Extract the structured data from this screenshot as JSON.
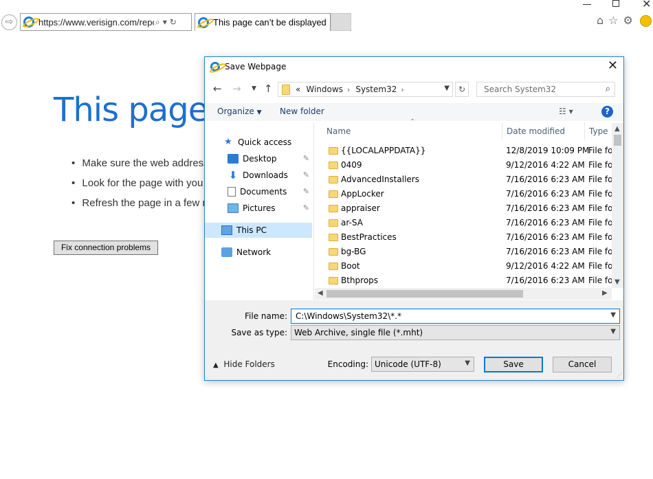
{
  "browser": {
    "address": "https://www.verisign.com/repos",
    "tab_title": "This page can’t be displayed"
  },
  "error_page": {
    "title": "This page",
    "bullets": [
      "Make sure the web address",
      "Look for the page with you",
      "Refresh the page in a few m"
    ],
    "fix_button": "Fix connection problems"
  },
  "dialog": {
    "title": "Save Webpage",
    "breadcrumb": {
      "prefix": "«",
      "items": [
        "Windows",
        "System32"
      ]
    },
    "search_placeholder": "Search System32",
    "toolbar": {
      "organize": "Organize",
      "new_folder": "New folder"
    },
    "nav_pane": {
      "quick_access": "Quick access",
      "items": [
        "Desktop",
        "Downloads",
        "Documents",
        "Pictures"
      ],
      "this_pc": "This PC",
      "network": "Network"
    },
    "columns": {
      "name": "Name",
      "date": "Date modified",
      "type": "Type"
    },
    "files": [
      {
        "name": "{{LOCALAPPDATA}}",
        "date": "12/8/2019 10:09 PM",
        "type": "File fol"
      },
      {
        "name": "0409",
        "date": "9/12/2016 4:22 AM",
        "type": "File fol"
      },
      {
        "name": "AdvancedInstallers",
        "date": "7/16/2016 6:23 AM",
        "type": "File fol"
      },
      {
        "name": "AppLocker",
        "date": "7/16/2016 6:23 AM",
        "type": "File fol"
      },
      {
        "name": "appraiser",
        "date": "7/16/2016 6:23 AM",
        "type": "File fol"
      },
      {
        "name": "ar-SA",
        "date": "7/16/2016 6:23 AM",
        "type": "File fol"
      },
      {
        "name": "BestPractices",
        "date": "7/16/2016 6:23 AM",
        "type": "File fol"
      },
      {
        "name": "bg-BG",
        "date": "7/16/2016 6:23 AM",
        "type": "File fol"
      },
      {
        "name": "Boot",
        "date": "9/12/2016 4:22 AM",
        "type": "File fol"
      },
      {
        "name": "Bthprops",
        "date": "7/16/2016 6:23 AM",
        "type": "File fol"
      }
    ],
    "file_name_label": "File name:",
    "file_name_value": "C:\\Windows\\System32\\*.*",
    "save_as_type_label": "Save as type:",
    "save_as_type_value": "Web Archive, single file (*.mht)",
    "hide_folders": "Hide Folders",
    "encoding_label": "Encoding:",
    "encoding_value": "Unicode (UTF-8)",
    "save_button": "Save",
    "cancel_button": "Cancel"
  },
  "colors": {
    "accent": "#0078d7",
    "error_title": "#1e6fd0",
    "selection": "#cce8ff",
    "folder": "#f8d775"
  }
}
